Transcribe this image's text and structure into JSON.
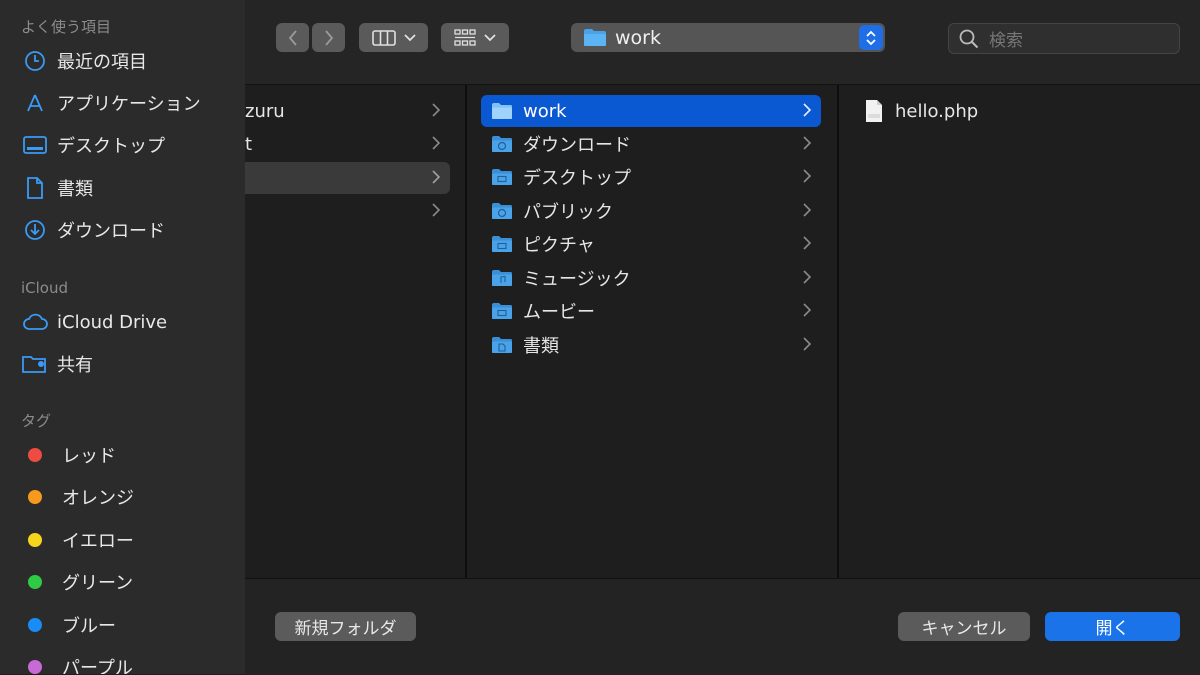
{
  "sidebar": {
    "favorites_header": "よく使う項目",
    "favorites": [
      {
        "label": "最近の項目",
        "icon": "clock-icon"
      },
      {
        "label": "アプリケーション",
        "icon": "applications-icon"
      },
      {
        "label": "デスクトップ",
        "icon": "desktop-icon"
      },
      {
        "label": "書類",
        "icon": "document-icon"
      },
      {
        "label": "ダウンロード",
        "icon": "download-icon"
      }
    ],
    "icloud_header": "iCloud",
    "icloud": [
      {
        "label": "iCloud Drive",
        "icon": "cloud-icon"
      },
      {
        "label": "共有",
        "icon": "shared-folder-icon"
      }
    ],
    "tags_header": "タグ",
    "tags": [
      {
        "label": "レッド",
        "color": "#ee4b43"
      },
      {
        "label": "オレンジ",
        "color": "#f59a1d"
      },
      {
        "label": "イエロー",
        "color": "#f7d51c"
      },
      {
        "label": "グリーン",
        "color": "#2fcb45"
      },
      {
        "label": "ブルー",
        "color": "#1a8cf5"
      },
      {
        "label": "パープル",
        "color": "#c86ad6"
      }
    ]
  },
  "toolbar": {
    "location": "work",
    "search_placeholder": "検索"
  },
  "column1": [
    {
      "label": "zuru"
    },
    {
      "label": "t"
    },
    {
      "label": ""
    },
    {
      "label": ""
    }
  ],
  "column2": [
    {
      "label": "work",
      "selected": true
    },
    {
      "label": "ダウンロード"
    },
    {
      "label": "デスクトップ"
    },
    {
      "label": "パブリック"
    },
    {
      "label": "ピクチャ"
    },
    {
      "label": "ミュージック"
    },
    {
      "label": "ムービー"
    },
    {
      "label": "書類"
    }
  ],
  "column3": [
    {
      "label": "hello.php"
    }
  ],
  "buttons": {
    "new_folder": "新規フォルダ",
    "cancel": "キャンセル",
    "open": "開く"
  },
  "colors": {
    "accent": "#0a58d2",
    "folder": "#4aa3e8"
  }
}
